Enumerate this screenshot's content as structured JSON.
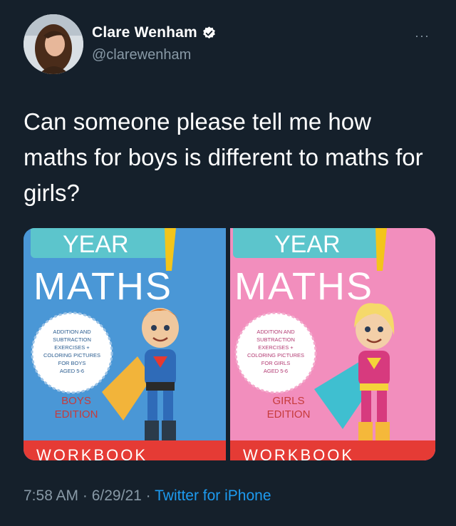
{
  "author": {
    "display_name": "Clare Wenham",
    "handle": "@clarewenham",
    "verified_icon": "verified-badge-icon"
  },
  "menu": {
    "more_label": "···"
  },
  "tweet": {
    "text": "Can someone please tell me how maths for boys is different to maths for girls?"
  },
  "media": {
    "boys_cover": {
      "year_label": "YEAR",
      "title": "MATHS",
      "badge_lines": [
        "ADDITION AND",
        "SUBTRACTION",
        "EXERCISES +",
        "COLORING PICTURES",
        "FOR BOYS",
        "AGED 5-6"
      ],
      "edition_line1": "BOYS",
      "edition_line2": "EDITION",
      "footer": "WORKBOOK",
      "bg_color": "#4a97d6"
    },
    "girls_cover": {
      "year_label": "YEAR",
      "title": "MATHS",
      "badge_lines": [
        "ADDITION AND",
        "SUBTRACTION",
        "EXERCISES +",
        "COLORING PICTURES",
        "FOR GIRLS",
        "AGED 5-6"
      ],
      "edition_line1": "GIRLS",
      "edition_line2": "EDITION",
      "footer": "WORKBOOK",
      "bg_color": "#f28ebd"
    }
  },
  "meta": {
    "time": "7:58 AM",
    "separator": " · ",
    "date": "6/29/21",
    "source": "Twitter for iPhone",
    "source_color": "#1d9bf0"
  }
}
